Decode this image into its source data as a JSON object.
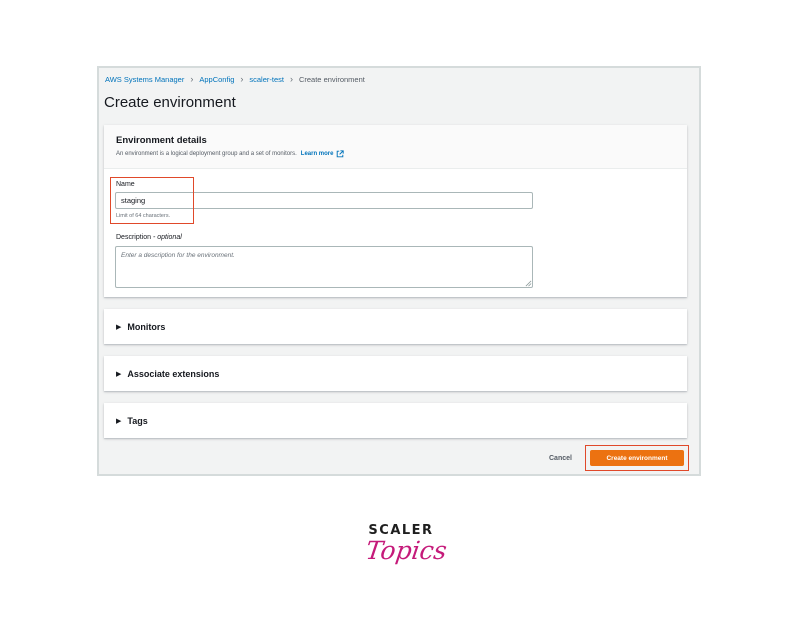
{
  "breadcrumb": {
    "items": [
      "AWS Systems Manager",
      "AppConfig",
      "scaler-test"
    ],
    "current": "Create environment"
  },
  "page": {
    "title": "Create environment"
  },
  "details": {
    "title": "Environment details",
    "description": "An environment is a logical deployment group and a set of monitors.",
    "learn_more": "Learn more",
    "name_label": "Name",
    "name_value": "staging",
    "name_constraint": "Limit of 64 characters.",
    "description_label": "Description",
    "description_optional": "- optional",
    "description_placeholder": "Enter a description for the environment."
  },
  "sections": [
    {
      "label": "Monitors"
    },
    {
      "label": "Associate extensions"
    },
    {
      "label": "Tags"
    }
  ],
  "footer": {
    "cancel": "Cancel",
    "submit": "Create environment"
  },
  "logo": {
    "line1": "SCALER",
    "line2": "Topics"
  },
  "colors": {
    "primary_button": "#ec7211",
    "link": "#0073bb",
    "highlight": "#e0492a",
    "brand_text": "#1f1f1f",
    "brand_script": "#c51a7a"
  },
  "icons": {
    "breadcrumb_separator": "chevron-right-icon",
    "learn_more": "external-link-icon",
    "section_toggle": "caret-right-icon"
  }
}
